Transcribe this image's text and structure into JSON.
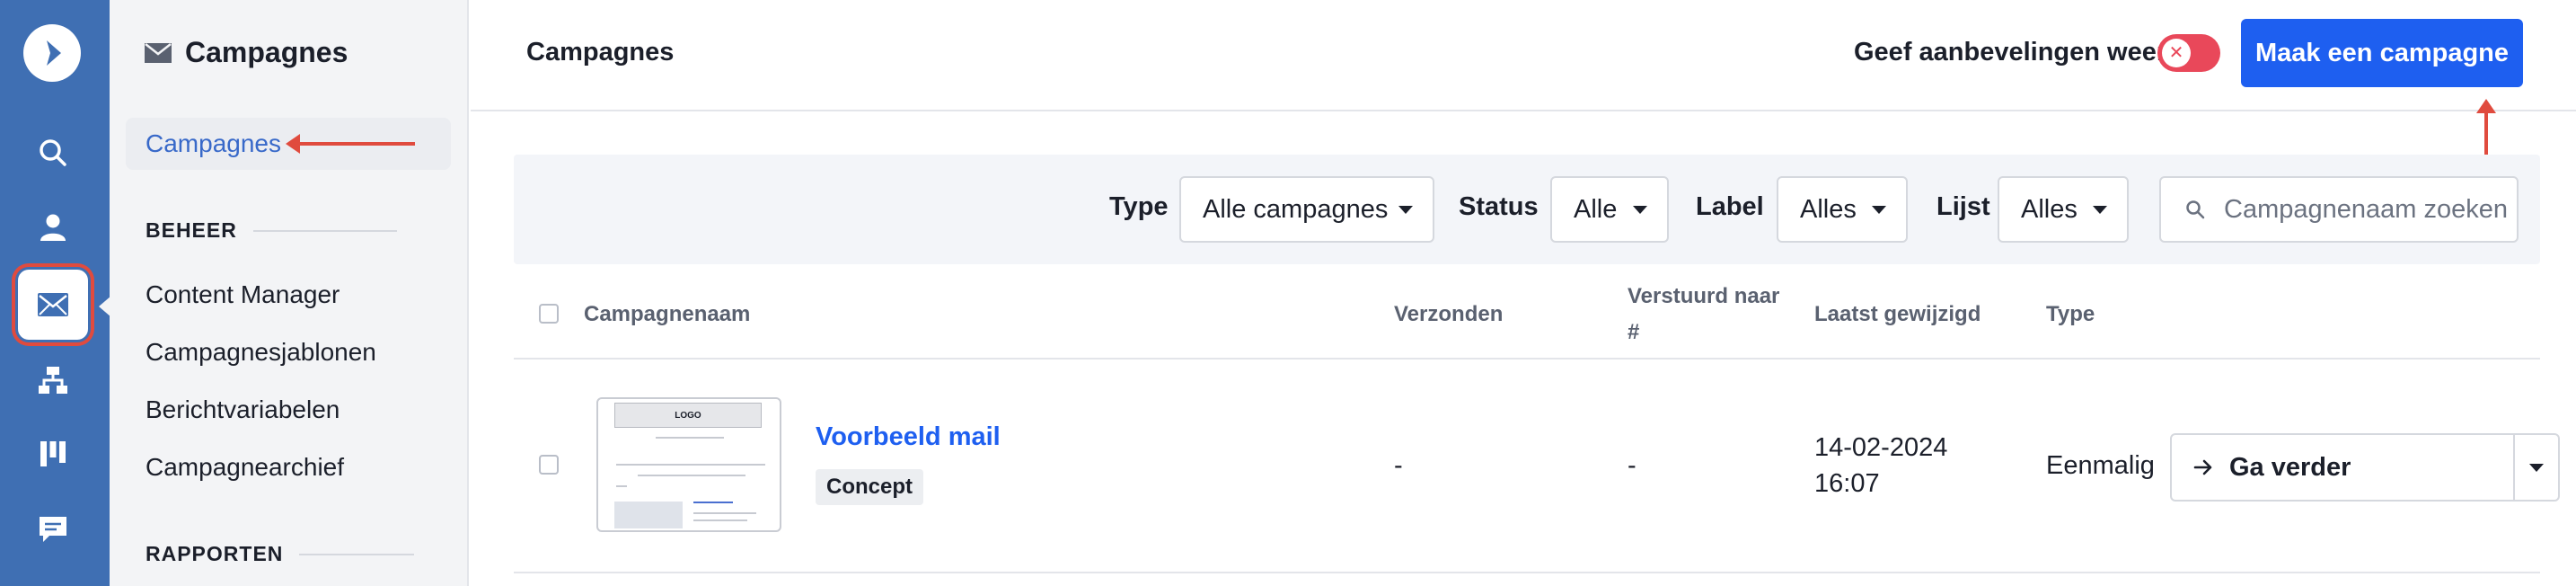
{
  "rail": {
    "items": [
      "search-icon",
      "user-icon",
      "mail-icon",
      "sitemap-icon",
      "board-icon",
      "chat-icon"
    ],
    "active": "mail-icon",
    "colors": {
      "background": "#3f6fb3",
      "highlight": "#e04b3e"
    }
  },
  "sidebar": {
    "title": "Campagnes",
    "active_item": "Campagnes",
    "sections": [
      {
        "title": "BEHEER",
        "items": [
          "Content Manager",
          "Campagnesjablonen",
          "Berichtvariabelen",
          "Campagnearchief"
        ]
      },
      {
        "title": "RAPPORTEN",
        "items": []
      }
    ]
  },
  "header": {
    "title": "Campagnes",
    "recommendations_label": "Geef aanbevelingen weer",
    "recommendations_toggle": "off",
    "create_button": "Maak een campagne",
    "accent": "#1e5ff0"
  },
  "filters": {
    "type": {
      "label": "Type",
      "value": "Alle campagnes"
    },
    "status": {
      "label": "Status",
      "value": "Alle"
    },
    "label": {
      "label": "Label",
      "value": "Alles"
    },
    "list": {
      "label": "Lijst",
      "value": "Alles"
    },
    "search_placeholder": "Campagnenaam zoeken"
  },
  "table": {
    "columns": [
      "Campagnenaam",
      "Verzonden",
      "Verstuurd naar",
      "#",
      "Laatst gewijzigd",
      "Type"
    ],
    "rows": [
      {
        "thumbnail": {
          "logo": "LOGO"
        },
        "name": "Voorbeeld mail",
        "status": "Concept",
        "sent": "-",
        "sent_to": "-",
        "modified_date": "14-02-2024",
        "modified_time": "16:07",
        "type": "Eenmalig",
        "action": "Ga verder"
      }
    ]
  }
}
